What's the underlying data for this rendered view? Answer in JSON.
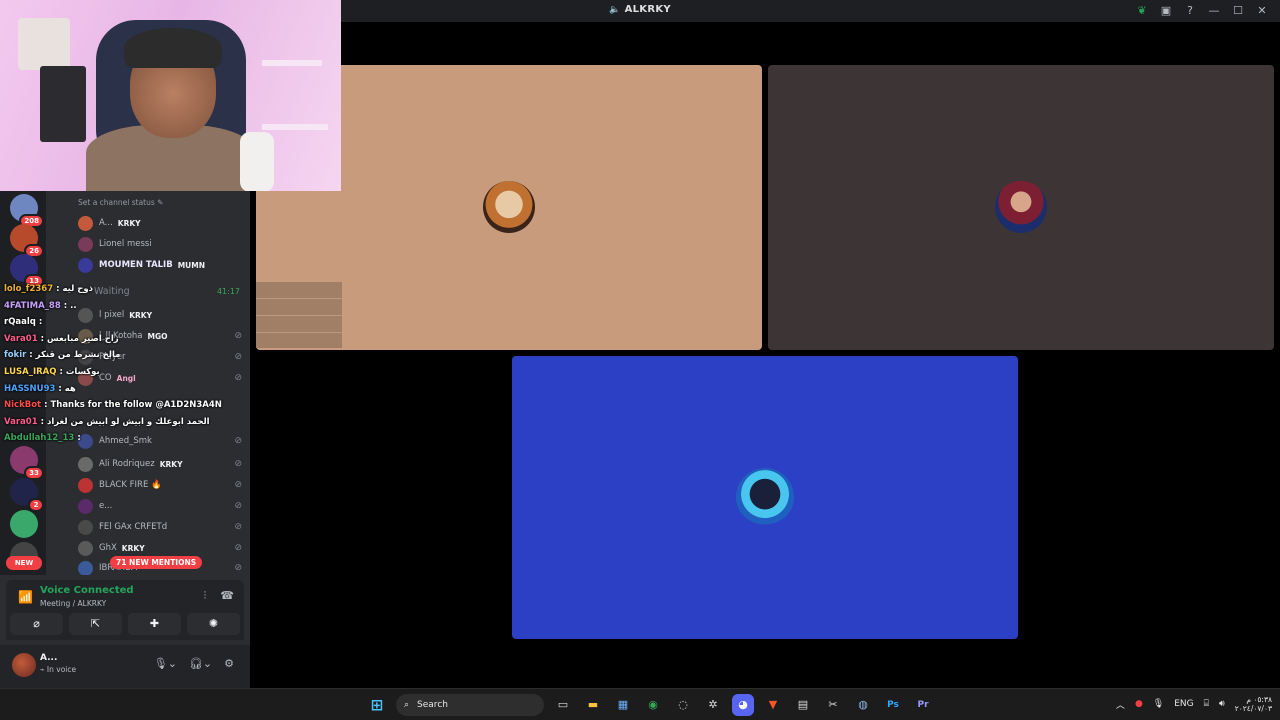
{
  "window": {
    "title": "ALKRKY",
    "title_icon": "speaker-icon"
  },
  "sidebar": {
    "status_hint": "Set a channel status",
    "waiting_label": "Waiting",
    "waiting_time": "41:17",
    "guild_badges": [
      "208",
      "26",
      "13",
      "33",
      "2"
    ],
    "members": [
      {
        "name": "A...",
        "tag": "KRKY"
      },
      {
        "name": "Lionel messi",
        "tag": ""
      },
      {
        "name": "MOUMEN TALIB",
        "tag": "MUMN"
      },
      {
        "name": "l pixel",
        "tag": "KRKY"
      },
      {
        "name": "l_ll Kotoha",
        "tag": "MGO"
      },
      {
        "name": "Player",
        "tag": ""
      },
      {
        "name": "CO",
        "tag": "Angl"
      },
      {
        "name": "Ahmed_Smk",
        "tag": ""
      },
      {
        "name": "Ali Rodriquez",
        "tag": "KRKY"
      },
      {
        "name": "BLACK FIRE 🔥",
        "tag": ""
      },
      {
        "name": "e...",
        "tag": ""
      },
      {
        "name": "FEl GAx CRFETd",
        "tag": ""
      },
      {
        "name": "GhX",
        "tag": "KRKY"
      },
      {
        "name": "IBRAHEM",
        "tag": ""
      }
    ],
    "new_label": "NEW",
    "mentions_label": "71 NEW MENTIONS"
  },
  "chat": [
    {
      "user": "lolo_f2367",
      "text": ": ذوح ليه",
      "color": "#f0b232"
    },
    {
      "user": "4FATIMA_88",
      "text": ": ..",
      "color": "#c9a0ff"
    },
    {
      "user": "rQaalq",
      "text": ":",
      "color": "#ffffff"
    },
    {
      "user": "Vara01",
      "text": ": راح اصير مبابعس",
      "color": "#ff5c8a"
    },
    {
      "user": "fokir",
      "text": ": مالخ نشرط من قنكر",
      "color": "#9ad0ff"
    },
    {
      "user": "LUSA_IRAQ",
      "text": ": بوكسات",
      "color": "#ffd84d"
    },
    {
      "user": "HASSNU93",
      "text": ": هه",
      "color": "#4da3ff"
    },
    {
      "user": "NickBot",
      "text": ": Thanks for the follow @A1D2N3A4N",
      "color": "#ff4d4d"
    },
    {
      "user": "Vara01",
      "text": ": الحمد ابوعلك و ابيش لو ابيش من لغراد",
      "color": "#ff5c8a"
    },
    {
      "user": "Abdullah12_13",
      "text": ":",
      "color": "#3ba55c"
    }
  ],
  "voice": {
    "status": "Voice Connected",
    "channel": "Meeting / ALKRKY"
  },
  "user": {
    "name": "A...",
    "status": "In voice"
  },
  "taskbar": {
    "search_placeholder": "Search",
    "lang": "ENG",
    "time": "٠٥:٣٨ م",
    "date": "٢٠٢٤/٠٧/٠٣"
  },
  "colors": {
    "tile1": "#c79b7c",
    "tile2": "#3d3435",
    "tile3": "#2b40c4",
    "voice_green": "#23a55a",
    "alert_red": "#f23f43"
  }
}
